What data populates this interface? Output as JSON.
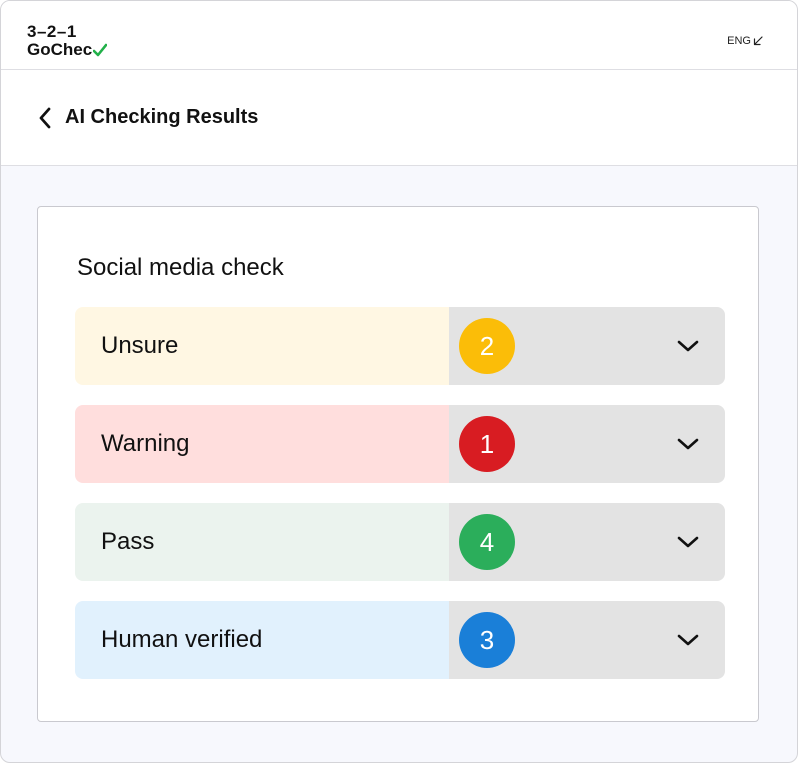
{
  "header": {
    "logo_line1": "3–2–1",
    "logo_line2": "GoChec",
    "logo_check_color": "#22b04a",
    "language_label": "ENG",
    "language_icon": "arrow-down-left-icon"
  },
  "title_bar": {
    "back_icon": "chevron-left-icon",
    "title": "AI Checking Results"
  },
  "card": {
    "title": "Social media check",
    "rows": [
      {
        "label": "Unsure",
        "count": "2",
        "label_bg": "#fff7e3",
        "badge_color": "#fbbd08"
      },
      {
        "label": "Warning",
        "count": "1",
        "label_bg": "#ffdedd",
        "badge_color": "#d81c22"
      },
      {
        "label": "Pass",
        "count": "4",
        "label_bg": "#ebf3ee",
        "badge_color": "#2bae5b"
      },
      {
        "label": "Human verified",
        "count": "3",
        "label_bg": "#e1f1fd",
        "badge_color": "#1a7fd8"
      }
    ],
    "row_expand_icon": "chevron-down-icon"
  }
}
